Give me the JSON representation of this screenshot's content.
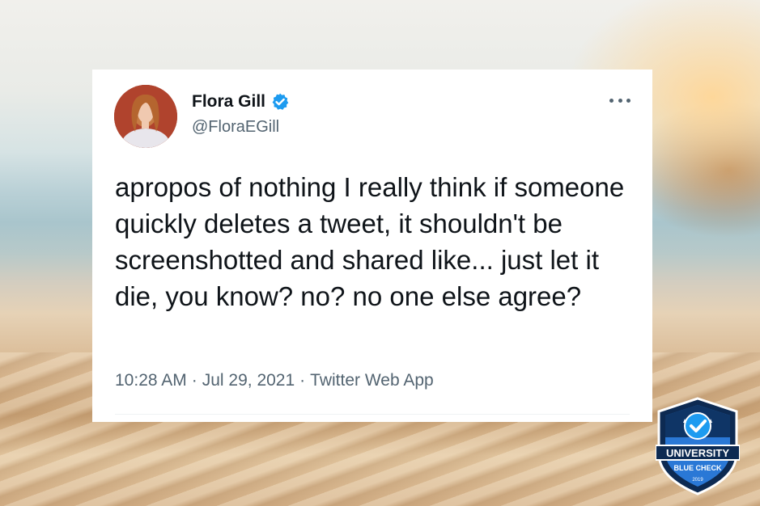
{
  "tweet": {
    "display_name": "Flora Gill",
    "handle": "@FloraEGill",
    "verified": true,
    "text": "apropos of nothing I really think if someone quickly deletes a tweet, it shouldn't be screenshotted and shared like... just let it die, you know? no? no one else agree?",
    "time": "10:28 AM",
    "date": "Jul 29, 2021",
    "source": "Twitter Web App",
    "separator": "·"
  },
  "badge": {
    "line1": "UNIVERSITY",
    "line2": "BLUE CHECK",
    "year": "2019"
  },
  "colors": {
    "verified_blue": "#1d9bf0",
    "text_primary": "#0f1419",
    "text_secondary": "#536471",
    "badge_navy": "#0d2a52",
    "badge_blue": "#2a78d6"
  },
  "icons": {
    "verified": "verified-check-icon",
    "more": "more-horizontal-icon"
  }
}
